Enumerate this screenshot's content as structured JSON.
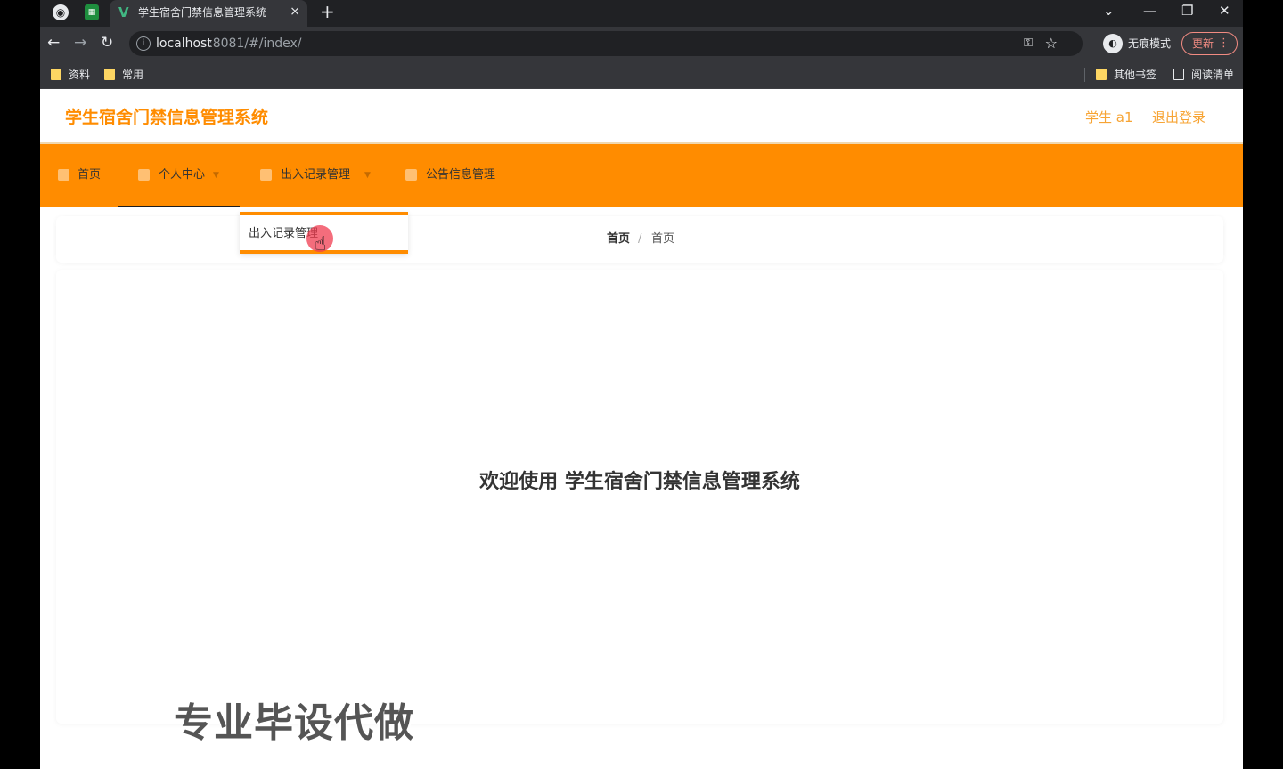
{
  "browser": {
    "tab": {
      "title": "学生宿舍门禁信息管理系统",
      "vue_logo": "V",
      "close": "×"
    },
    "new_tab": "+",
    "window_controls": {
      "down": "⌄",
      "minimize": "—",
      "restore": "❐",
      "close": "✕"
    },
    "nav": {
      "back": "←",
      "forward": "→",
      "reload": "↻"
    },
    "url": {
      "host": "localhost",
      "path": ":8081/#/index/"
    },
    "incognito_label": "无痕模式",
    "update_label": "更新",
    "bookmarks": [
      {
        "label": "资料"
      },
      {
        "label": "常用"
      }
    ],
    "other_bookmarks": "其他书签",
    "reading_list": "阅读清单"
  },
  "app": {
    "title": "学生宿舍门禁信息管理系统",
    "user": "学生 a1",
    "logout": "退出登录",
    "nav": [
      {
        "label": "首页",
        "active": false
      },
      {
        "label": "个人中心",
        "active": true
      },
      {
        "label": "出入记录管理",
        "active": false
      },
      {
        "label": "公告信息管理",
        "active": false
      }
    ],
    "dropdown_item": "出入记录管理",
    "breadcrumb": [
      "首页",
      "首页"
    ],
    "breadcrumb_sep": "/",
    "welcome": "欢迎使用 学生宿舍门禁信息管理系统"
  },
  "watermark": "专业毕设代做",
  "colors": {
    "accent": "#ff8c00",
    "header_text": "#f7a434"
  }
}
